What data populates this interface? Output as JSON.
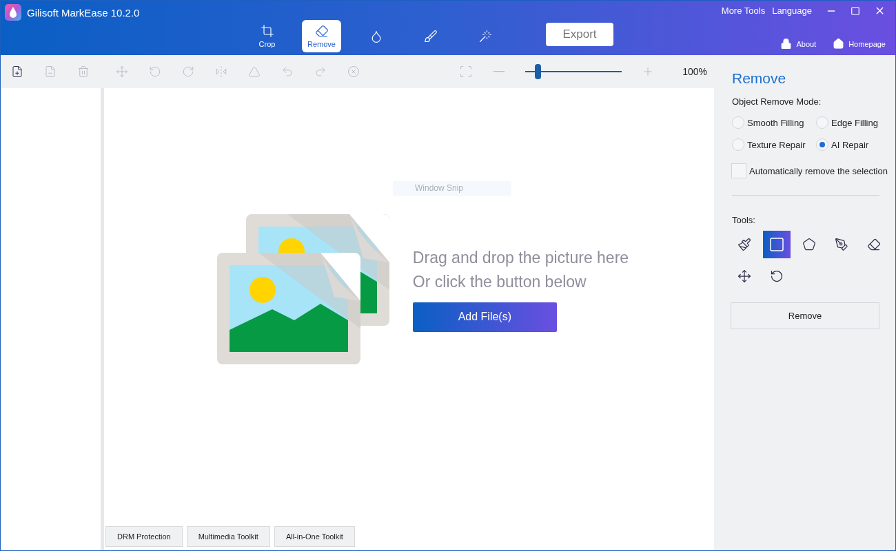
{
  "window": {
    "title": "Gilisoft MarkEase 10.2.0"
  },
  "header_links": [
    "More Tools",
    "Language"
  ],
  "nav_tabs": [
    {
      "label": "Crop",
      "selected": false
    },
    {
      "label": "Remove",
      "selected": true
    },
    {
      "selected": false
    },
    {
      "selected": false
    },
    {
      "selected": false
    }
  ],
  "export_button": "Export",
  "account_links": [
    "About",
    "Homepage"
  ],
  "toolbar": {
    "buttons": [
      {
        "disabled": false
      },
      {
        "disabled": true
      },
      {
        "disabled": true
      },
      {
        "disabled": true
      },
      {
        "disabled": true
      },
      {
        "disabled": true
      },
      {
        "disabled": true
      },
      {
        "disabled": true
      },
      {
        "disabled": true
      },
      {
        "disabled": true
      },
      {
        "disabled": true
      }
    ],
    "zoom": {
      "level": 0.13,
      "reading": "100%"
    }
  },
  "canvas": {
    "overlay_label": "Window Snip",
    "hint_lines": [
      "Drag and drop the picture here",
      "Or click the button below"
    ],
    "add_button": "Add File(s)"
  },
  "footer_buttons": [
    "DRM Protection",
    "Multimedia Toolkit",
    "All-in-One Toolkit"
  ],
  "panel": {
    "title": "Remove",
    "mode_label": "Object Remove Mode:",
    "modes": [
      {
        "label": "Smooth Filling",
        "selected": false
      },
      {
        "label": "Edge Filling",
        "selected": false
      },
      {
        "label": "Texture Repair",
        "selected": false
      },
      {
        "label": "AI Repair",
        "selected": true
      }
    ],
    "auto_remove": {
      "label": "Automatically remove the selection",
      "checked": false
    },
    "tools_label": "Tools:",
    "tools": [
      {
        "selected": false
      },
      {
        "selected": true
      },
      {
        "selected": false
      },
      {
        "selected": false
      },
      {
        "selected": false
      },
      {
        "selected": false
      },
      {
        "selected": false
      }
    ],
    "action_button": "Remove"
  }
}
